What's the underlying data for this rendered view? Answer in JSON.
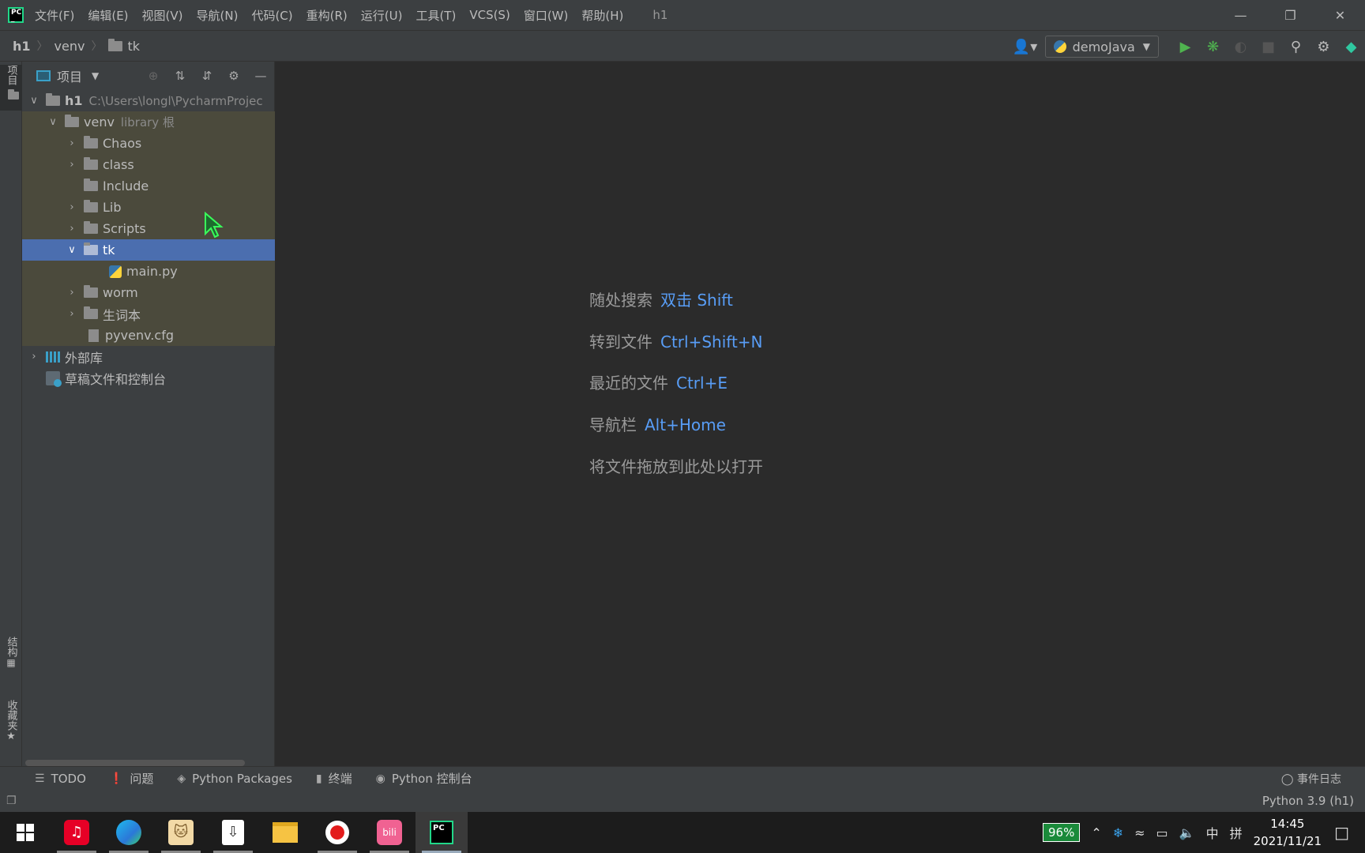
{
  "app": {
    "window_title": "h1",
    "menu": [
      "文件(F)",
      "编辑(E)",
      "视图(V)",
      "导航(N)",
      "代码(C)",
      "重构(R)",
      "运行(U)",
      "工具(T)",
      "VCS(S)",
      "窗口(W)",
      "帮助(H)"
    ]
  },
  "breadcrumb": [
    "h1",
    "venv",
    "tk"
  ],
  "run_config": "demoJava",
  "left_strip": {
    "project": "项目",
    "structure": "结构",
    "favorites": "收藏夹"
  },
  "project_panel": {
    "title": "项目",
    "root": {
      "name": "h1",
      "path": "C:\\Users\\longl\\PycharmProjec"
    },
    "venv": {
      "name": "venv",
      "note": "library 根"
    },
    "items": [
      "Chaos",
      "class",
      "Include",
      "Lib",
      "Scripts",
      "tk",
      "main.py",
      "worm",
      "生词本",
      "pyvenv.cfg"
    ],
    "external_libs": "外部库",
    "scratches": "草稿文件和控制台"
  },
  "editor_hints": [
    {
      "label": "随处搜索",
      "key": "双击 Shift"
    },
    {
      "label": "转到文件",
      "key": "Ctrl+Shift+N"
    },
    {
      "label": "最近的文件",
      "key": "Ctrl+E"
    },
    {
      "label": "导航栏",
      "key": "Alt+Home"
    },
    {
      "label": "将文件拖放到此处以打开",
      "key": ""
    }
  ],
  "tool_windows": [
    "TODO",
    "问题",
    "Python Packages",
    "终端",
    "Python 控制台"
  ],
  "event_log": "事件日志",
  "status": {
    "interpreter": "Python 3.9 (h1)"
  },
  "taskbar": {
    "battery": "96%",
    "ime_lang": "中",
    "ime_mode": "拼",
    "time": "14:45",
    "date": "2021/11/21"
  },
  "colors": {
    "accent_key": "#589df6",
    "selection": "#4b6eaf",
    "battery": "#1a8a3a"
  }
}
